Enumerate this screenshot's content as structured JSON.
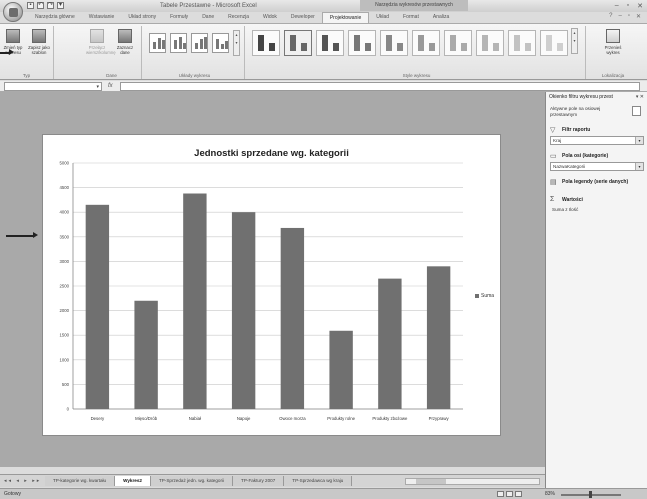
{
  "window": {
    "title": "Tabele Przestawne - Microsoft Excel",
    "context_title": "Narzędzia wykresów przestawnych",
    "controls": [
      "–",
      "▫",
      "✕"
    ]
  },
  "ribbon": {
    "tabs": [
      "Narzędzia główne",
      "Wstawianie",
      "Układ strony",
      "Formuły",
      "Dane",
      "Recenzja",
      "Widok",
      "Deweloper",
      "Projektowanie",
      "Układ",
      "Format",
      "Analiza"
    ],
    "active_tab": "Projektowanie",
    "groups": {
      "type": {
        "label": "Typ",
        "change_type": "Zmień typ wykresu",
        "save_template": "Zapisz jako szablon"
      },
      "data": {
        "label": "Dane",
        "switch_row_col": "Przełącz wiersz/kolumnę",
        "select_data": "Zaznacz dane"
      },
      "layouts": {
        "label": "Układy wykresu"
      },
      "styles": {
        "label": "Style wykresu"
      },
      "location": {
        "label": "Lokalizacja",
        "move_chart": "Przenieś wykres"
      }
    }
  },
  "formula_bar": {
    "name_box": "",
    "fx": "fx",
    "content": ""
  },
  "chart_data": {
    "type": "bar",
    "title": "Jednostki sprzedane wg. kategorii",
    "categories": [
      "Desery",
      "Mięso/Drób",
      "Nabiał",
      "Napoje",
      "Owoce morza",
      "Produkty rolne",
      "Produkty zbożowe",
      "Przyprawy"
    ],
    "series": [
      {
        "name": "Suma",
        "values": [
          4150,
          2200,
          4380,
          4000,
          3680,
          1590,
          2650,
          2900
        ]
      }
    ],
    "ylim": [
      0,
      5000
    ],
    "yticks": [
      0,
      500,
      1000,
      1500,
      2000,
      2500,
      3000,
      3500,
      4000,
      4500,
      5000
    ],
    "grid": true,
    "legend_position": "right",
    "bar_color": "#707070"
  },
  "sheets": {
    "nav": "◂◂ ◂ ▸ ▸▸",
    "tabs": [
      "TP-kategorie wg. kwartału",
      "Wykres2",
      "TP-Sprzedaż jedn. wg. kategorii",
      "TP-Faktury 2007",
      "TP-Sprzedawca wg kraju"
    ],
    "active": "Wykres2"
  },
  "status": {
    "text": "Gotowy",
    "zoom": "83%"
  },
  "pane": {
    "title": "Okienko filtru wykresu przest",
    "controls": "▾ ✕",
    "subtitle": "Aktywne pole na osiowej przestawnym",
    "report_filter": {
      "label": "Filtr raportu",
      "icon": "filter-icon",
      "value": "Kraj"
    },
    "axis_fields": {
      "label": "Pola osi (kategorie)",
      "icon": "axis-icon",
      "value": "NazwaKategorii"
    },
    "legend_fields": {
      "label": "Pola legendy (serie danych)",
      "icon": "legend-icon"
    },
    "values": {
      "label": "Wartości",
      "icon": "sigma-icon",
      "value": "Suma z Ilość"
    }
  }
}
